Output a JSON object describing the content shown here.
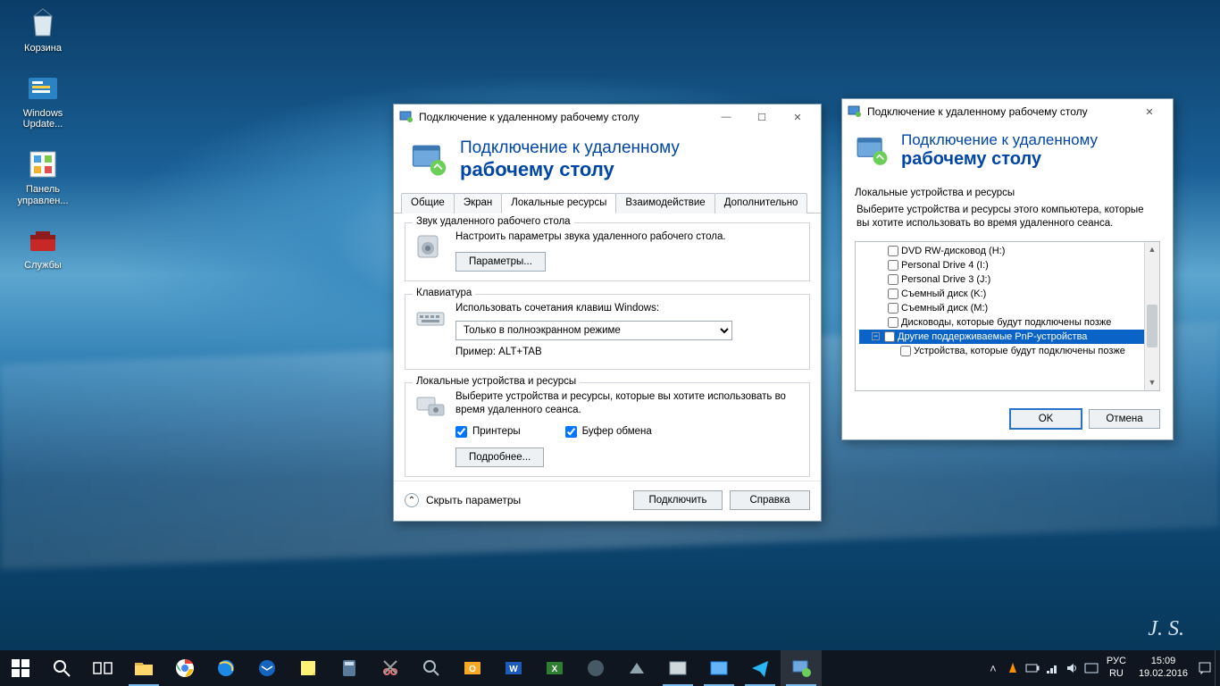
{
  "desktop": {
    "icons": [
      {
        "name": "recycle-bin",
        "label": "Корзина"
      },
      {
        "name": "windows-update",
        "label": "Windows Update..."
      },
      {
        "name": "control-panel",
        "label": "Панель управлен..."
      },
      {
        "name": "services",
        "label": "Службы"
      }
    ]
  },
  "win1": {
    "title": "Подключение к удаленному рабочему столу",
    "banner_l1": "Подключение к удаленному",
    "banner_l2": "рабочему столу",
    "tabs": [
      "Общие",
      "Экран",
      "Локальные ресурсы",
      "Взаимодействие",
      "Дополнительно"
    ],
    "active_tab": 2,
    "audio": {
      "legend": "Звук удаленного рабочего стола",
      "desc": "Настроить параметры звука удаленного рабочего стола.",
      "btn": "Параметры..."
    },
    "keyboard": {
      "legend": "Клавиатура",
      "desc": "Использовать сочетания клавиш Windows:",
      "value": "Только в полноэкранном режиме",
      "example_lbl": "Пример: ALT+TAB"
    },
    "local": {
      "legend": "Локальные устройства и ресурсы",
      "desc": "Выберите устройства и ресурсы, которые вы хотите использовать во время удаленного сеанса.",
      "chk1": "Принтеры",
      "chk2": "Буфер обмена",
      "btn": "Подробнее..."
    },
    "footer": {
      "hide": "Скрыть параметры",
      "connect": "Подключить",
      "help": "Справка"
    }
  },
  "win2": {
    "title": "Подключение к удаленному рабочему столу",
    "banner_l1": "Подключение к удаленному",
    "banner_l2": "рабочему столу",
    "section": "Локальные устройства и ресурсы",
    "desc": "Выберите устройства и ресурсы этого компьютера, которые вы хотите использовать во время удаленного сеанса.",
    "items": [
      "DVD RW-дисковод (H:)",
      "Personal Drive 4 (I:)",
      "Personal Drive 3 (J:)",
      "Съемный диск (K:)",
      "Съемный диск (M:)",
      "Дисководы, которые будут подключены позже",
      "Другие поддерживаемые PnP-устройства",
      "Устройства, которые будут подключены позже"
    ],
    "selected_index": 6,
    "ok": "OK",
    "cancel": "Отмена"
  },
  "taskbar": {
    "lang1": "РУС",
    "lang2": "RU",
    "time": "15:09",
    "date": "19.02.2016"
  },
  "signature": "J. S."
}
